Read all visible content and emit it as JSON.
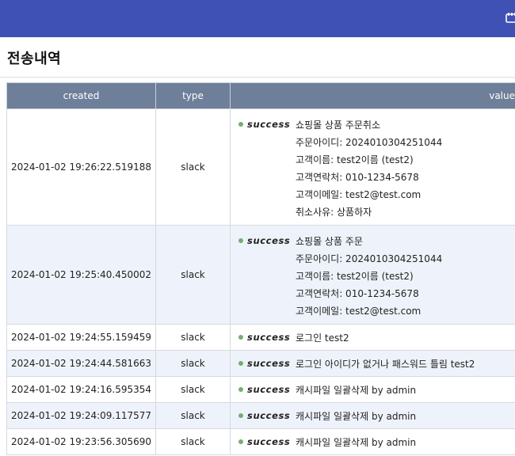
{
  "page": {
    "title": "전송내역"
  },
  "topbar": {
    "icon": "clipboard-icon"
  },
  "table": {
    "columns": [
      "created",
      "type",
      "value"
    ],
    "rows": [
      {
        "created": "2024-01-02 19:26:22.519188",
        "type": "slack",
        "status": "success",
        "lines": [
          "쇼핑몰 상품 주문취소",
          "주문아이디: 2024010304251044",
          "고객이름: test2이름 (test2)",
          "고객연락처: 010-1234-5678",
          "고객이메일: test2@test.com",
          "취소사유: 상품하자"
        ]
      },
      {
        "created": "2024-01-02 19:25:40.450002",
        "type": "slack",
        "status": "success",
        "lines": [
          "쇼핑몰 상품 주문",
          "주문아이디: 2024010304251044",
          "고객이름: test2이름 (test2)",
          "고객연락처: 010-1234-5678",
          "고객이메일: test2@test.com"
        ]
      },
      {
        "created": "2024-01-02 19:24:55.159459",
        "type": "slack",
        "status": "success",
        "lines": [
          "로그인 test2"
        ]
      },
      {
        "created": "2024-01-02 19:24:44.581663",
        "type": "slack",
        "status": "success",
        "lines": [
          "로그인 아이디가 없거나 패스워드 틀림 test2"
        ]
      },
      {
        "created": "2024-01-02 19:24:16.595354",
        "type": "slack",
        "status": "success",
        "lines": [
          "캐시파일 일괄삭제 by admin"
        ]
      },
      {
        "created": "2024-01-02 19:24:09.117577",
        "type": "slack",
        "status": "success",
        "lines": [
          "캐시파일 일괄삭제 by admin"
        ]
      },
      {
        "created": "2024-01-02 19:23:56.305690",
        "type": "slack",
        "status": "success",
        "lines": [
          "캐시파일 일괄삭제 by admin"
        ]
      }
    ]
  },
  "colors": {
    "topbar": "#3f51b5",
    "header": "#6e7f99",
    "alt_row": "#eef3fb",
    "success_dot": "#72b06b"
  }
}
